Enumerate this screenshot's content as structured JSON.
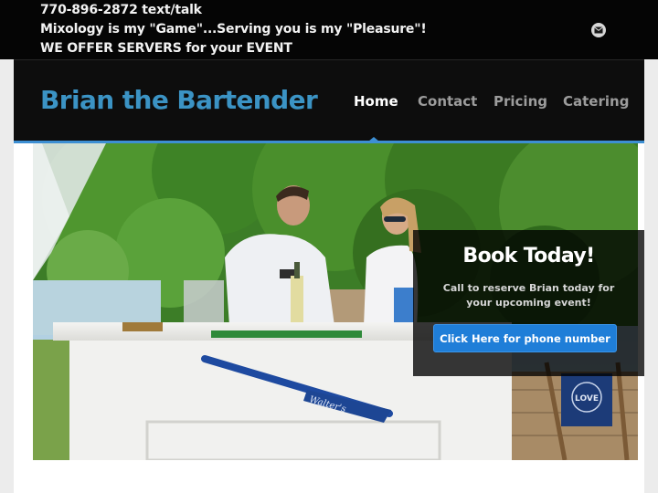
{
  "topbar": {
    "line1": "770-896-2872 text/talk",
    "line2": "Mixology is my \"Game\"...Serving you is my \"Pleasure\"!",
    "line3": "WE OFFER SERVERS for your EVENT",
    "email_icon": "envelope-icon"
  },
  "header": {
    "logo": "Brian the Bartender",
    "nav": [
      "Home",
      "Contact",
      "Pricing",
      "Catering"
    ],
    "active_nav": "Home"
  },
  "hero": {
    "oar_text": "Walter's",
    "sign_text": "LOVE"
  },
  "book": {
    "title": "Book Today!",
    "text": "Call to reserve Brian today for your upcoming event!",
    "button": "Click Here for phone number"
  },
  "colors": {
    "logo": "#3b93c4",
    "accent": "#3d8fd3",
    "button": "#1f7ed8"
  }
}
